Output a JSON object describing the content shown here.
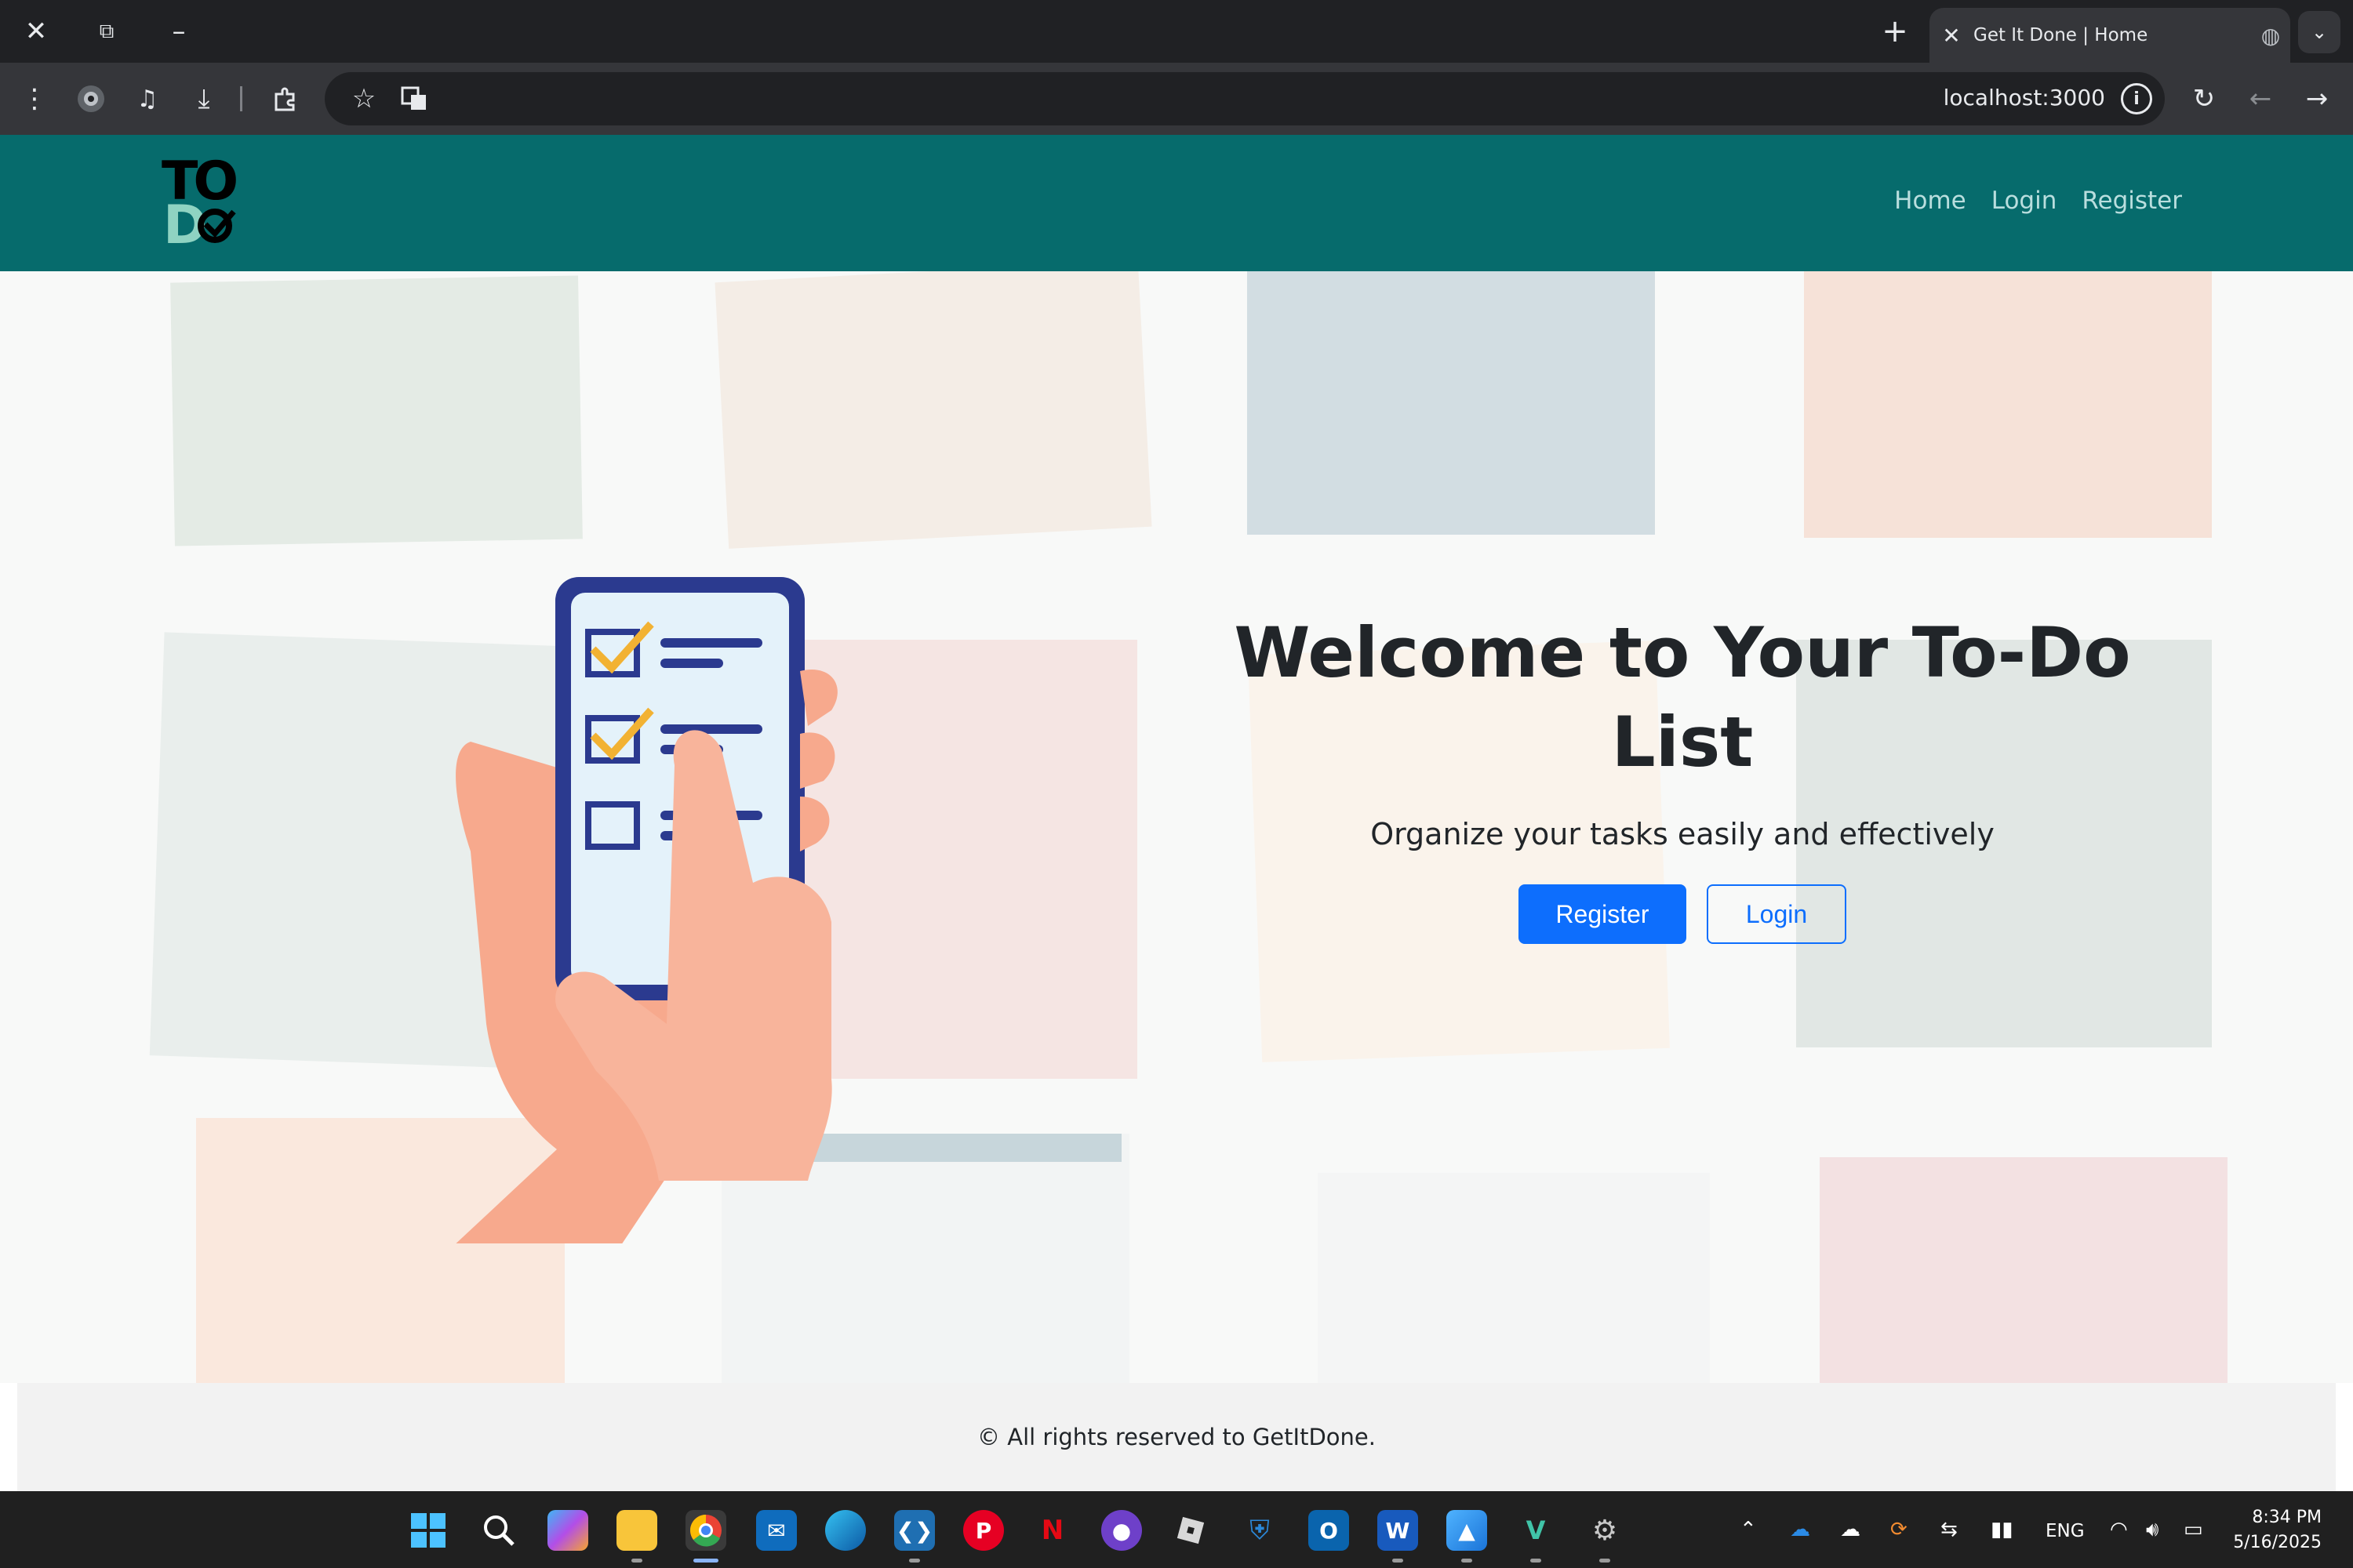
{
  "browser": {
    "tab_title": "Get It Done | Home",
    "url": "localhost:3000"
  },
  "site": {
    "logo": {
      "top_text": "TO",
      "bottom_text": "D"
    },
    "nav": [
      {
        "label": "Home"
      },
      {
        "label": "Login"
      },
      {
        "label": "Register"
      }
    ]
  },
  "hero": {
    "title": "Welcome to Your To-Do List",
    "subtitle": "Organize your tasks easily and effectively",
    "register_label": "Register",
    "login_label": "Login"
  },
  "footer": {
    "text": "© All rights reserved to GetItDone."
  },
  "taskbar": {
    "language": "ENG",
    "time": "8:34 PM",
    "date": "5/16/2025"
  },
  "colors": {
    "header": "#066b6c",
    "primary": "#0d6efd",
    "hand": "#f7a98d",
    "phone_frame": "#2b3a8f",
    "check": "#f2b233"
  }
}
